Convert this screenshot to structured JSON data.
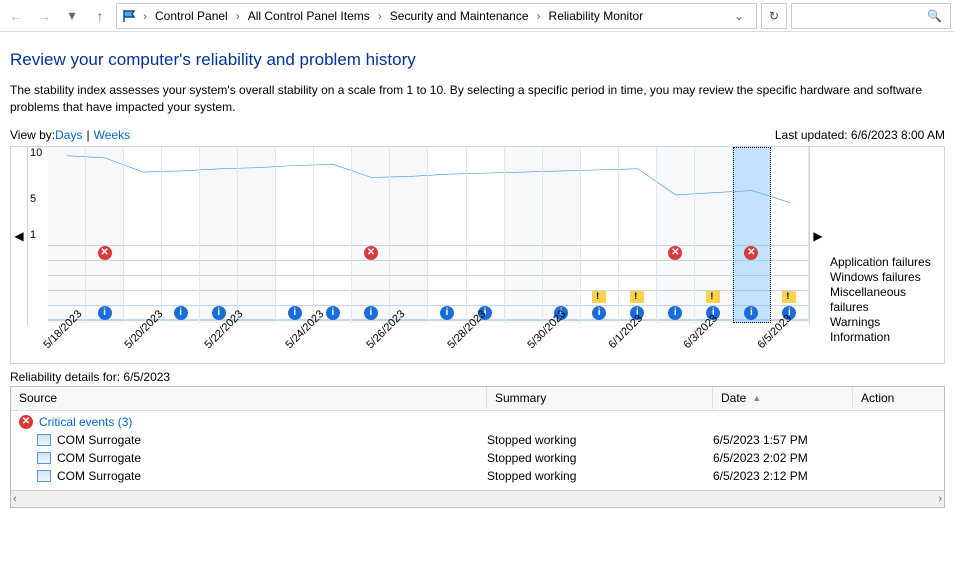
{
  "breadcrumb": {
    "items": [
      "Control Panel",
      "All Control Panel Items",
      "Security and Maintenance",
      "Reliability Monitor"
    ]
  },
  "page": {
    "title": "Review your computer's reliability and problem history",
    "intro": "The stability index assesses your system's overall stability on a scale from 1 to 10. By selecting a specific period in time, you may review the specific hardware and software problems that have impacted your system."
  },
  "viewby": {
    "label": "View by: ",
    "days": "Days",
    "weeks": "Weeks",
    "last_updated": "Last updated: 6/6/2023 8:00 AM"
  },
  "chart_data": {
    "type": "line",
    "title": "",
    "ylabel": "",
    "ylim": [
      1,
      10
    ],
    "y_ticks": [
      10,
      5,
      1
    ],
    "categories": [
      "5/18/2023",
      "5/19/2023",
      "5/20/2023",
      "5/21/2023",
      "5/22/2023",
      "5/23/2023",
      "5/24/2023",
      "5/25/2023",
      "5/26/2023",
      "5/27/2023",
      "5/28/2023",
      "5/29/2023",
      "5/30/2023",
      "5/31/2023",
      "6/1/2023",
      "6/2/2023",
      "6/3/2023",
      "6/4/2023",
      "6/5/2023",
      "6/6/2023"
    ],
    "series": [
      {
        "name": "Stability index",
        "values": [
          9.2,
          9,
          7.7,
          7.8,
          8,
          8.1,
          8.3,
          8.4,
          7.2,
          7.3,
          7.5,
          7.6,
          7.7,
          7.8,
          7.9,
          8,
          5.6,
          5.8,
          6,
          4.9
        ]
      }
    ],
    "event_rows": [
      "Application failures",
      "Windows failures",
      "Miscellaneous failures",
      "Warnings",
      "Information"
    ],
    "events_per_day": {
      "5/19/2023": {
        "app_fail": true,
        "info": true
      },
      "5/21/2023": {
        "info": true
      },
      "5/22/2023": {
        "info": true
      },
      "5/24/2023": {
        "info": true
      },
      "5/25/2023": {
        "info": true
      },
      "5/26/2023": {
        "app_fail": true,
        "info": true
      },
      "5/28/2023": {
        "info": true
      },
      "5/29/2023": {
        "info": true
      },
      "5/31/2023": {
        "info": true
      },
      "6/1/2023": {
        "warn": true,
        "info": true
      },
      "6/2/2023": {
        "warn": true,
        "info": true
      },
      "6/3/2023": {
        "app_fail": true,
        "info": true
      },
      "6/4/2023": {
        "warn": true,
        "info": true
      },
      "6/5/2023": {
        "app_fail": true,
        "info": true
      },
      "6/6/2023": {
        "warn": true,
        "info": true
      }
    },
    "selected_day": "6/5/2023",
    "date_labels": [
      "5/18/2023",
      "5/20/2023",
      "5/22/2023",
      "5/24/2023",
      "5/26/2023",
      "5/28/2023",
      "5/30/2023",
      "6/1/2023",
      "6/3/2023",
      "6/5/2023"
    ]
  },
  "details": {
    "header_prefix": "Reliability details for: ",
    "header_date": "6/5/2023",
    "columns": {
      "source": "Source",
      "summary": "Summary",
      "date": "Date",
      "action": "Action"
    },
    "group": {
      "label": "Critical events (3)"
    },
    "rows": [
      {
        "source": "COM Surrogate",
        "summary": "Stopped working",
        "date": "6/5/2023 1:57 PM"
      },
      {
        "source": "COM Surrogate",
        "summary": "Stopped working",
        "date": "6/5/2023 2:02 PM"
      },
      {
        "source": "COM Surrogate",
        "summary": "Stopped working",
        "date": "6/5/2023 2:12 PM"
      }
    ]
  }
}
